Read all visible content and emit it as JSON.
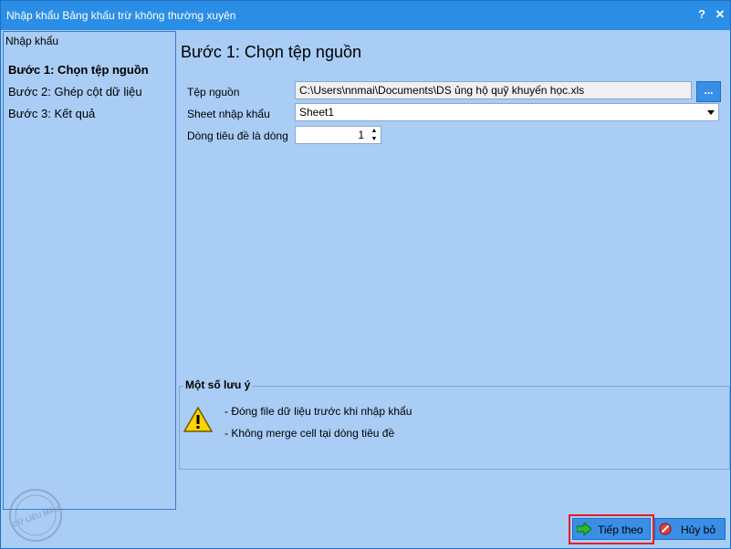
{
  "window": {
    "title": "Nhập khẩu Bảng khấu trừ không thường xuyên",
    "help_label": "?",
    "close_label": "✕"
  },
  "left_panel": {
    "title": "Nhập khẩu",
    "steps": [
      {
        "label": "Bước 1: Chọn tệp nguồn",
        "active": true
      },
      {
        "label": "Bước 2: Ghép cột dữ liệu",
        "active": false
      },
      {
        "label": "Bước 3: Kết quả",
        "active": false
      }
    ]
  },
  "main": {
    "title": "Bước 1: Chọn tệp nguồn",
    "source_file": {
      "label": "Tệp nguồn",
      "value": "C:\\Users\\nnmai\\Documents\\DS ủng hộ quỹ khuyến học.xls",
      "browse_label": "..."
    },
    "sheet": {
      "label": "Sheet nhập khẩu",
      "value": "Sheet1"
    },
    "header_row": {
      "label": "Dòng tiêu đề là dòng",
      "value": "1"
    }
  },
  "notes": {
    "title": "Một số lưu ý",
    "lines": [
      "- Đóng file dữ liệu trước khi nhập khẩu",
      "- Không merge cell tại dòng tiêu đề"
    ]
  },
  "buttons": {
    "next_label": "Tiếp theo",
    "cancel_label": "Hủy bỏ"
  },
  "watermark": {
    "text": "DỮ LIỆU MẪU"
  },
  "colors": {
    "title_bar": "#2b8ee6",
    "panel_bg": "#a9cdf5",
    "button_bg": "#3a8ee6",
    "highlight": "#e11d2a"
  }
}
